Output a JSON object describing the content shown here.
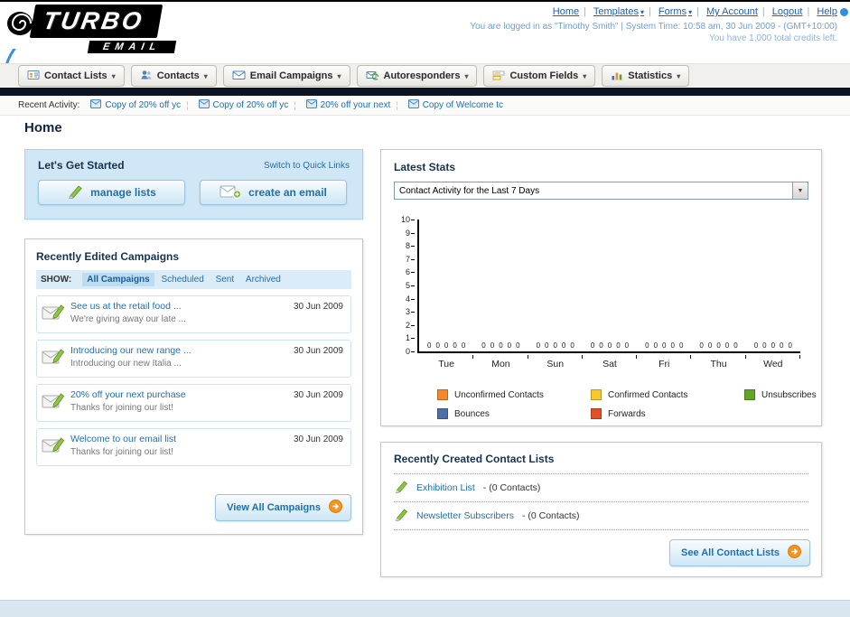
{
  "header": {
    "logo_title": "TURBO",
    "logo_subtitle": "EMAIL",
    "links": [
      {
        "label": "Home",
        "arrow": false
      },
      {
        "label": "Templates",
        "arrow": true
      },
      {
        "label": "Forms",
        "arrow": true
      },
      {
        "label": "My Account",
        "arrow": false
      },
      {
        "label": "Logout",
        "arrow": false
      },
      {
        "label": "Help",
        "arrow": false
      }
    ],
    "status": "You are logged in as \"Timothy Smith\" | System Time: 10:58 am, 30 Jun 2009 - (GMT+10:00)",
    "credits": "You have 1,000 total credits left."
  },
  "nav_tabs": [
    {
      "label": "Contact Lists",
      "icon": "contact-lists-icon"
    },
    {
      "label": "Contacts",
      "icon": "contacts-icon"
    },
    {
      "label": "Email Campaigns",
      "icon": "email-campaigns-icon"
    },
    {
      "label": "Autoresponders",
      "icon": "autoresponders-icon"
    },
    {
      "label": "Custom Fields",
      "icon": "custom-fields-icon"
    },
    {
      "label": "Statistics",
      "icon": "statistics-icon"
    }
  ],
  "activity": {
    "label": "Recent Activity:",
    "items": [
      "Copy of 20% off yc",
      "Copy of 20% off yc",
      "20% off your next",
      "Copy of Welcome tc"
    ]
  },
  "page_title": "Home",
  "get_started": {
    "title": "Let's Get Started",
    "switch_link": "Switch to Quick Links",
    "manage_lists_label": "manage lists",
    "create_email_label": "create an email"
  },
  "campaigns": {
    "title": "Recently Edited Campaigns",
    "show_label": "SHOW:",
    "filters": [
      {
        "label": "All Campaigns",
        "selected": true
      },
      {
        "label": "Scheduled",
        "selected": false
      },
      {
        "label": "Sent",
        "selected": false
      },
      {
        "label": "Archived",
        "selected": false
      }
    ],
    "items": [
      {
        "title": "See us at the retail food ...",
        "subtitle": "We're giving away our late ...",
        "date": "30 Jun 2009"
      },
      {
        "title": "Introducing our new range ...",
        "subtitle": "Introducing our new Italia ...",
        "date": "30 Jun 2009"
      },
      {
        "title": "20% off your next purchase",
        "subtitle": "Thanks for joining our list!",
        "date": "30 Jun 2009"
      },
      {
        "title": "Welcome to our email list",
        "subtitle": "Thanks for joining our list!",
        "date": "30 Jun 2009"
      }
    ],
    "view_all_label": "View All Campaigns"
  },
  "stats": {
    "title": "Latest Stats",
    "selector_value": "Contact Activity for the Last 7 Days"
  },
  "chart_data": {
    "type": "bar",
    "title": "Contact Activity for the Last 7 Days",
    "categories": [
      "Tue",
      "Mon",
      "Sun",
      "Sat",
      "Fri",
      "Thu",
      "Wed"
    ],
    "series": [
      {
        "name": "Unconfirmed Contacts",
        "color": "#f6882c",
        "values": [
          0,
          0,
          0,
          0,
          0,
          0,
          0
        ]
      },
      {
        "name": "Confirmed Contacts",
        "color": "#f9c82f",
        "values": [
          0,
          0,
          0,
          0,
          0,
          0,
          0
        ]
      },
      {
        "name": "Unsubscribes",
        "color": "#63a527",
        "values": [
          0,
          0,
          0,
          0,
          0,
          0,
          0
        ]
      },
      {
        "name": "Bounces",
        "color": "#4d6fa8",
        "values": [
          0,
          0,
          0,
          0,
          0,
          0,
          0
        ]
      },
      {
        "name": "Forwards",
        "color": "#e2502a",
        "values": [
          0,
          0,
          0,
          0,
          0,
          0,
          0
        ]
      }
    ],
    "ylim": [
      0,
      10
    ],
    "ytick_step": 1,
    "grid": false,
    "legend_position": "bottom"
  },
  "contact_lists": {
    "title": "Recently Created Contact Lists",
    "items": [
      {
        "name": "Exhibition List",
        "detail": "- (0 Contacts)"
      },
      {
        "name": "Newsletter Subscribers",
        "detail": "- (0 Contacts)"
      }
    ],
    "see_all_label": "See All Contact Lists"
  }
}
